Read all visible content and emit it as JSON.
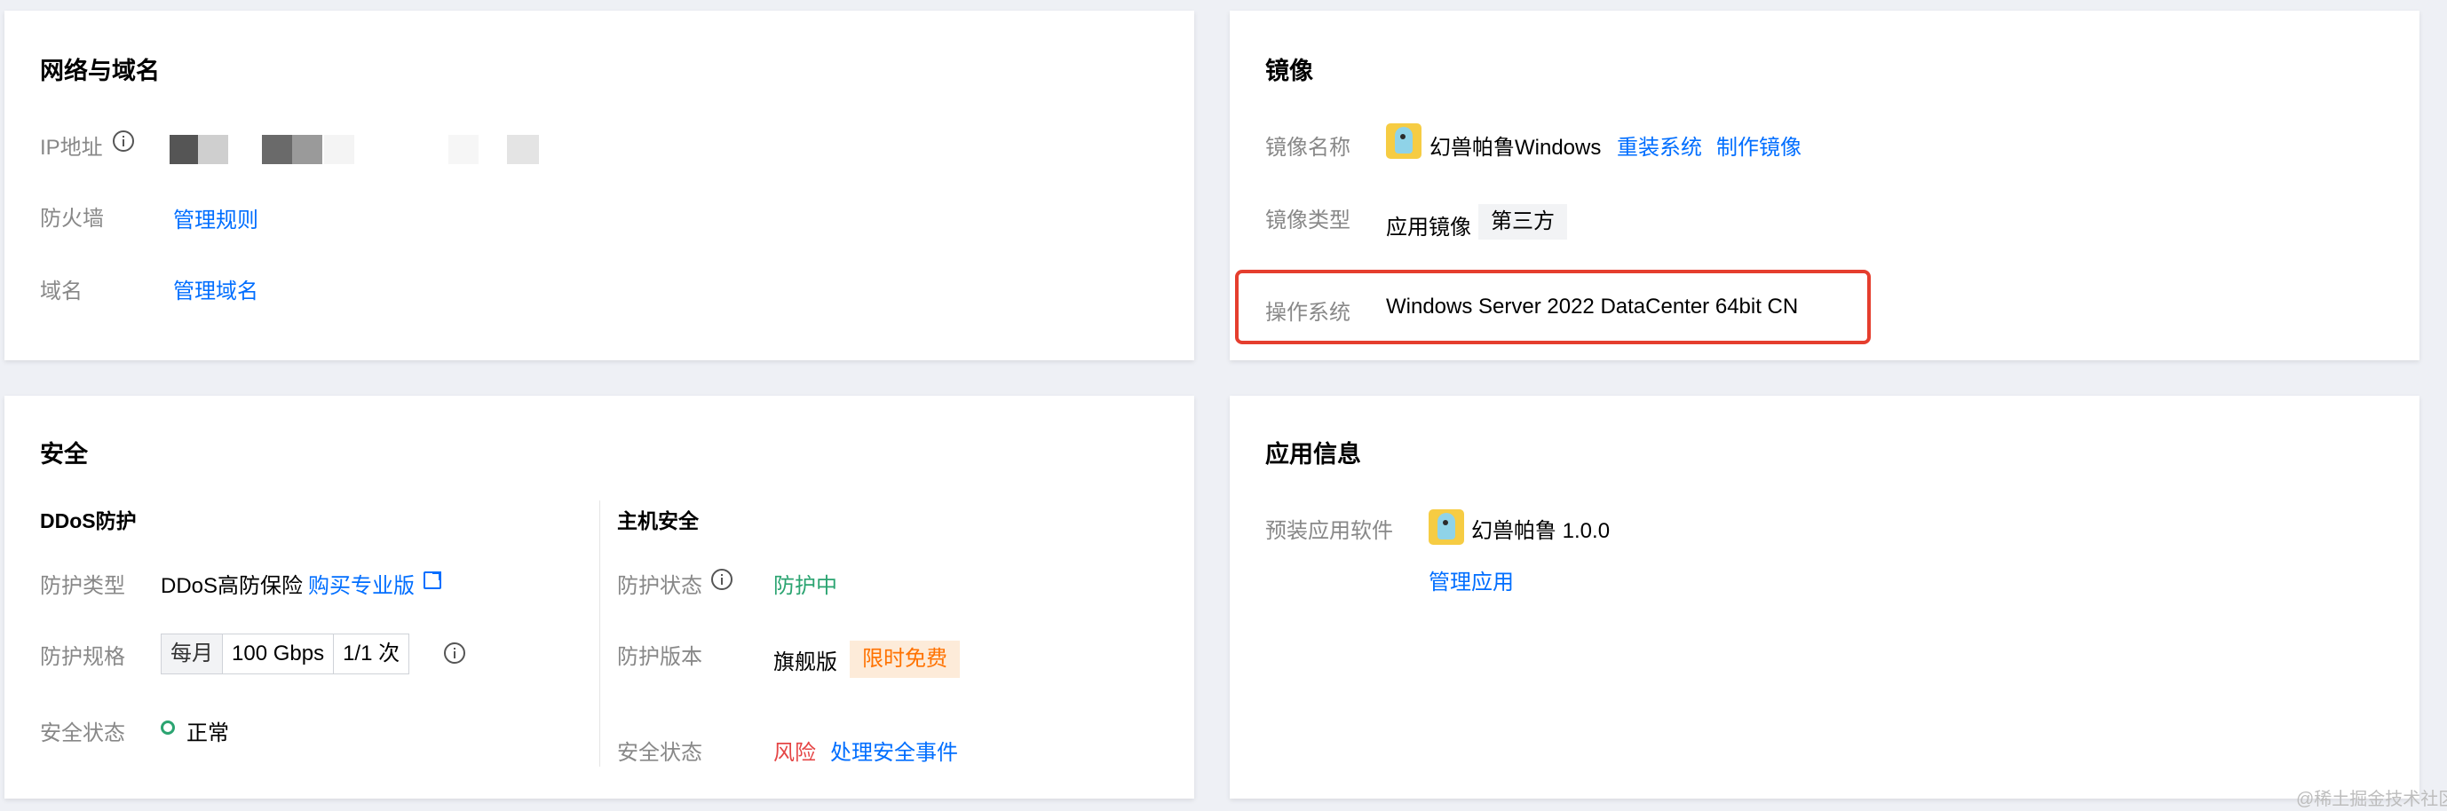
{
  "network": {
    "title": "网络与域名",
    "ip_label": "IP地址",
    "firewall_label": "防火墙",
    "firewall_link": "管理规则",
    "domain_label": "域名",
    "domain_link": "管理域名"
  },
  "image": {
    "title": "镜像",
    "name_label": "镜像名称",
    "name_value": "幻兽帕鲁Windows",
    "reinstall_link": "重装系统",
    "make_image_link": "制作镜像",
    "type_label": "镜像类型",
    "type_value": "应用镜像",
    "type_tag": "第三方",
    "os_label": "操作系统",
    "os_value": "Windows Server 2022 DataCenter 64bit CN"
  },
  "security": {
    "title": "安全",
    "ddos": {
      "title": "DDoS防护",
      "type_label": "防护类型",
      "type_value": "DDoS高防保险",
      "buy_link": "购买专业版",
      "spec_label": "防护规格",
      "spec_period": "每月",
      "spec_bandwidth": "100 Gbps",
      "spec_count": "1/1 次",
      "status_label": "安全状态",
      "status_value": "正常"
    },
    "host": {
      "title": "主机安全",
      "status_label": "防护状态",
      "status_value": "防护中",
      "version_label": "防护版本",
      "version_value": "旗舰版",
      "version_tag": "限时免费",
      "safety_label": "安全状态",
      "safety_value": "风险",
      "handle_link": "处理安全事件"
    }
  },
  "app_info": {
    "title": "应用信息",
    "software_label": "预装应用软件",
    "software_value": "幻兽帕鲁 1.0.0",
    "manage_link": "管理应用"
  },
  "watermark": "@稀土掘金技术社区",
  "colors": {
    "link": "#006eff",
    "success": "#2ba471",
    "danger": "#e54545",
    "warning": "#ff7200",
    "highlight": "#e53e2e"
  }
}
